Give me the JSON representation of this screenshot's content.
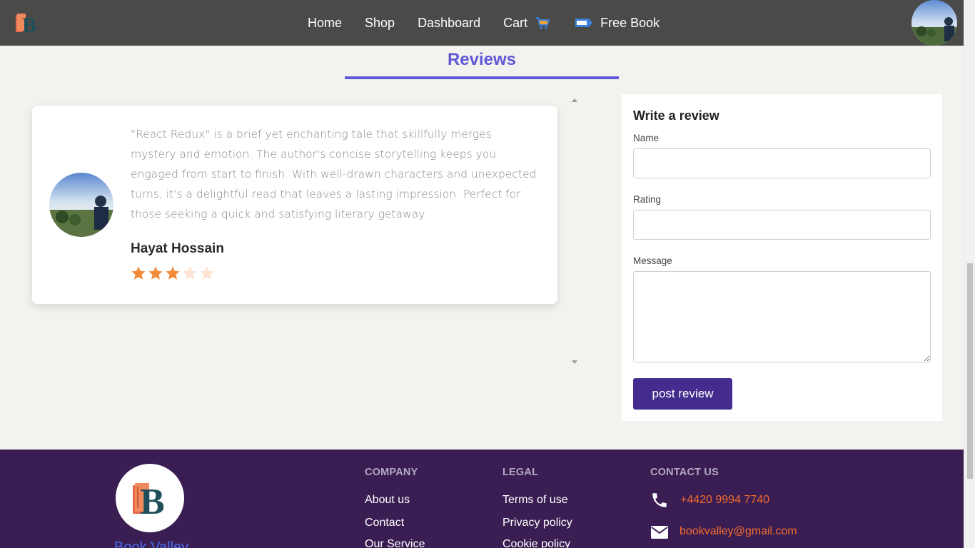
{
  "nav": {
    "logo_icon": "book-logo-icon",
    "items": [
      {
        "label": "Home"
      },
      {
        "label": "Shop"
      },
      {
        "label": "Dashboard"
      },
      {
        "label": "Cart",
        "icon": "cart-icon"
      },
      {
        "label": "Free Book",
        "icon": "free-tag-icon"
      }
    ],
    "avatar_icon": "user-avatar"
  },
  "reviews": {
    "heading": "Reviews",
    "accent_color": "#6059d6",
    "items": [
      {
        "text": "\"React Redux\" is a brief yet enchanting tale that skillfully merges mystery and emotion. The author's concise storytelling keeps you engaged from start to finish. With well-drawn characters and unexpected turns, it's a delightful read that leaves a lasting impression. Perfect for those seeking a quick and satisfying literary getaway.",
        "name": "Hayat Hossain",
        "rating": 3,
        "rating_max": 5
      }
    ]
  },
  "form": {
    "title": "Write a review",
    "name_label": "Name",
    "name_value": "",
    "rating_label": "Rating",
    "rating_value": "",
    "message_label": "Message",
    "message_value": "",
    "submit_label": "post review",
    "button_color": "#432c8e"
  },
  "footer": {
    "brand": "Book Valley",
    "company": {
      "heading": "COMPANY",
      "links": [
        "About us",
        "Contact",
        "Our Service"
      ]
    },
    "legal": {
      "heading": "LEGAL",
      "links": [
        "Terms of use",
        "Privacy policy",
        "Cookie policy"
      ]
    },
    "contact": {
      "heading": "CONTACT US",
      "phone": "+4420 9994 7740",
      "email": "bookvalley@gmail.com"
    },
    "bg_color": "#3a1d52",
    "link_accent": "#f26d2e"
  }
}
